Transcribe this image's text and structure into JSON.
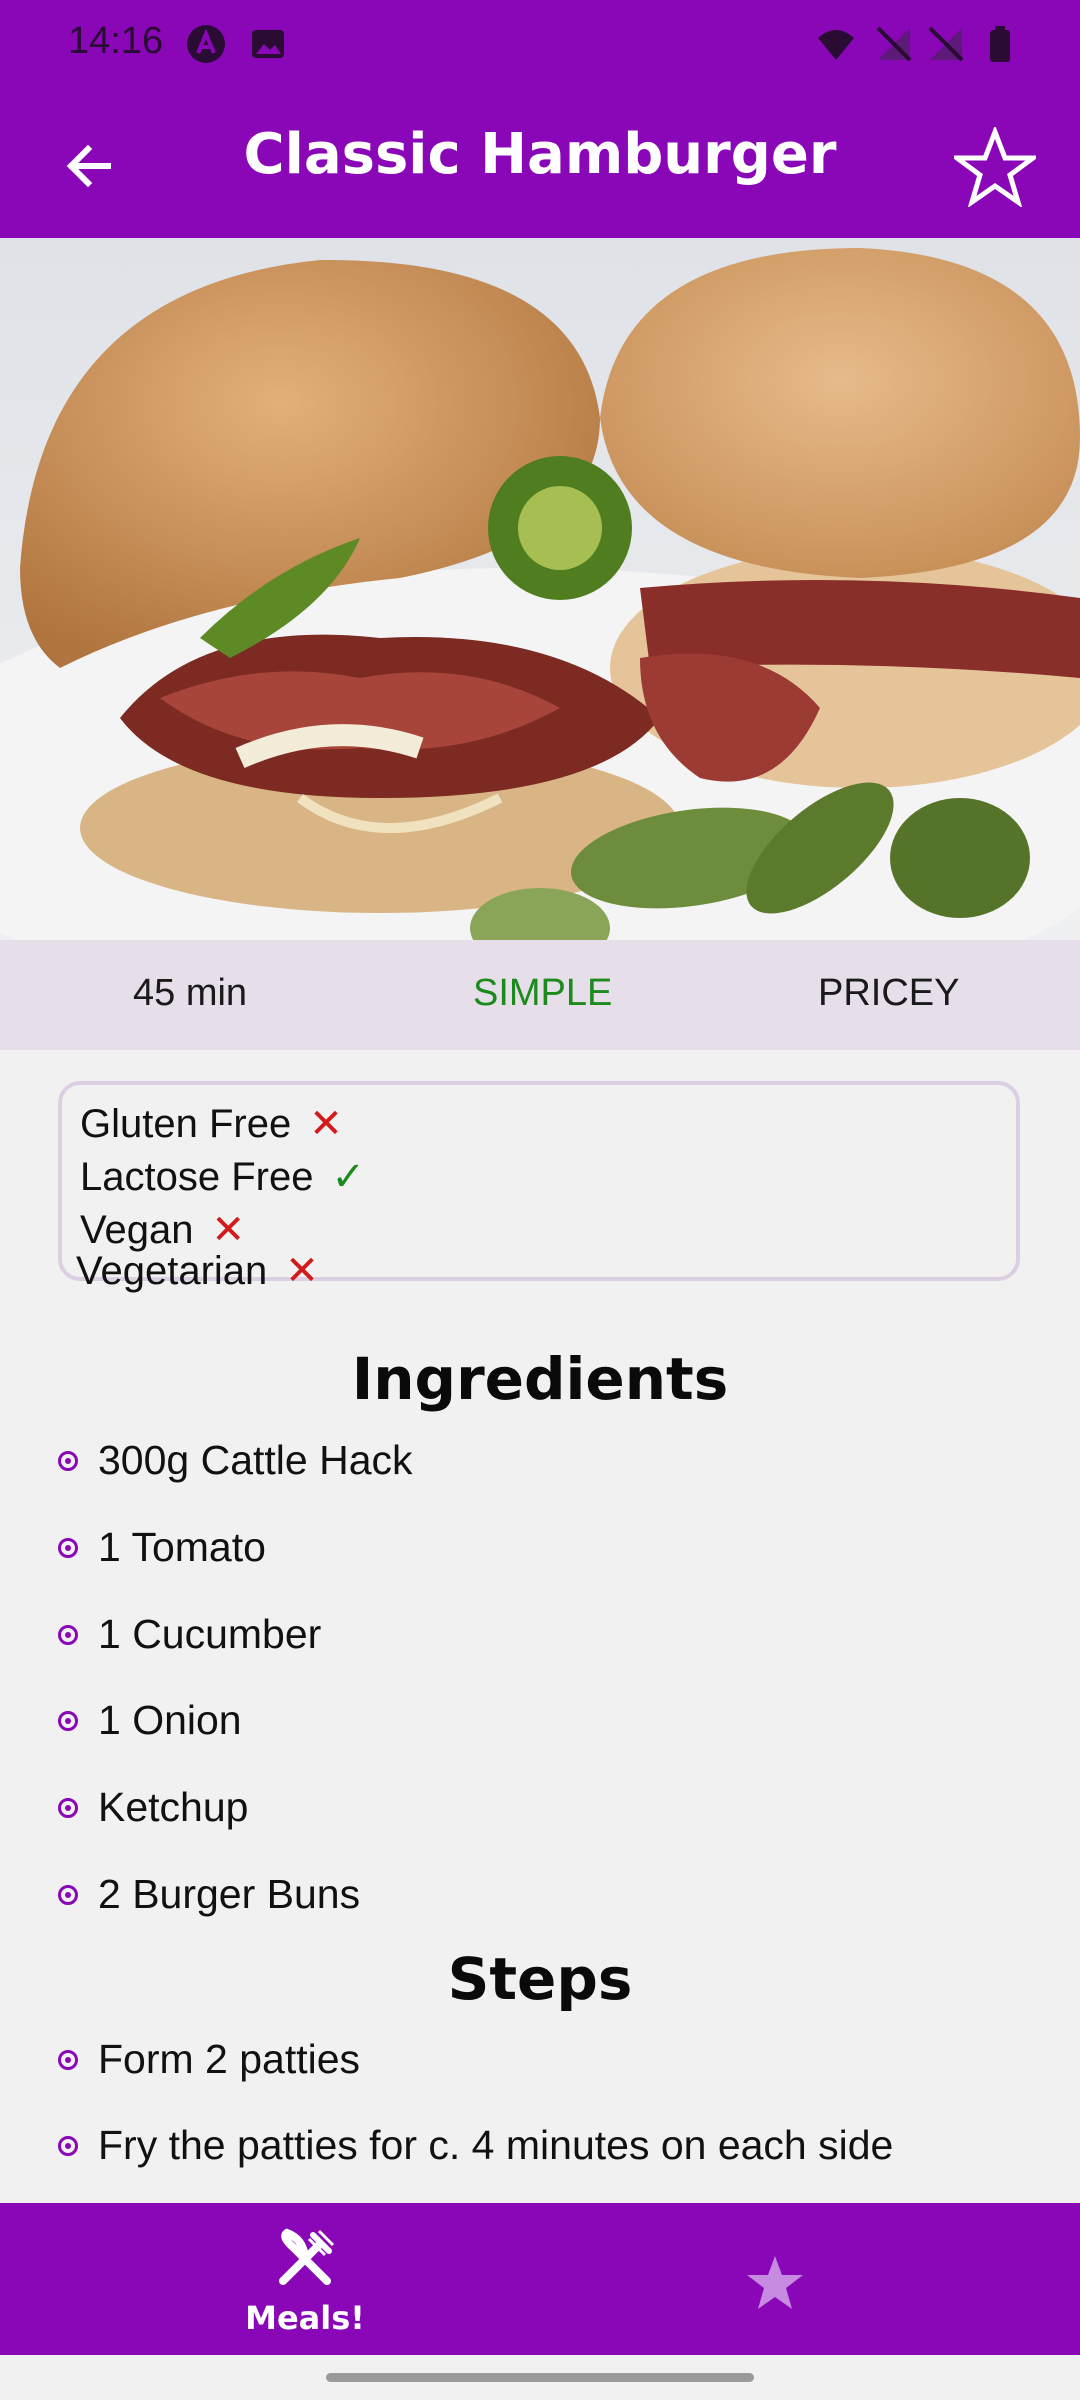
{
  "status": {
    "time": "14:16"
  },
  "appbar": {
    "title": "Classic Hamburger"
  },
  "hero": {
    "alt": "hamburger-photo"
  },
  "info": {
    "duration": "45 min",
    "complexity": "SIMPLE",
    "affordability": "PRICEY"
  },
  "diet": [
    {
      "label": "Gluten Free",
      "mark": "✕"
    },
    {
      "label": "Lactose Free",
      "mark": "✓"
    },
    {
      "label": "Vegan",
      "mark": "✕"
    },
    {
      "label": "Vegetarian",
      "mark": "✕"
    }
  ],
  "ingredients_title": "Ingredients",
  "ingredients": [
    "300g Cattle Hack",
    "1 Tomato",
    "1 Cucumber",
    "1 Onion",
    "Ketchup",
    "2 Burger Buns"
  ],
  "steps_title": "Steps",
  "steps": [
    "Form 2 patties",
    "Fry the patties for c. 4 minutes on each side"
  ],
  "nav": {
    "meals_label": "Meals!"
  },
  "colors": {
    "primary": "#8a07b8",
    "success": "#1c8a1c",
    "error": "#d31919"
  }
}
